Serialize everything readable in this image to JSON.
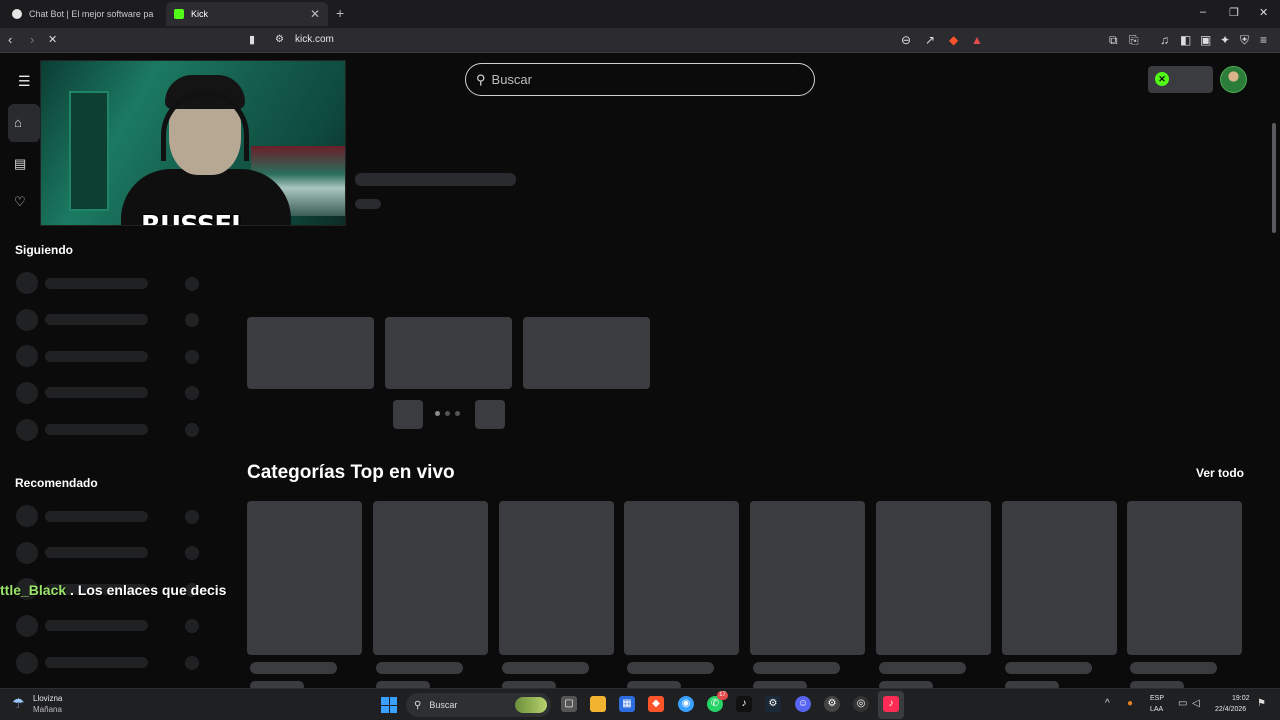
{
  "browser": {
    "tabs": [
      {
        "title": "Chat Bot | El mejor software para pot",
        "active": false,
        "favicon_color": "#e5e5e5"
      },
      {
        "title": "Kick",
        "active": true,
        "favicon_color": "#53fc18"
      }
    ],
    "new_tab_icon": "plus-icon",
    "window_controls": {
      "minimize": "–",
      "restore": "❐",
      "close": "✕"
    },
    "url": "kick.com"
  },
  "header": {
    "menu_icon": "menu-icon",
    "search_placeholder": "Buscar",
    "brand_color": "#53fc18"
  },
  "sidebar": {
    "following_title": "Siguiendo",
    "recommended_title": "Recomendado"
  },
  "main": {
    "categories_title": "Categorías Top en vivo",
    "see_all": "Ver todo"
  },
  "overlay": {
    "streamer_name": "RUSSEL",
    "chat_user": "ttle_Black",
    "chat_message": " . Los enlaces que decis",
    "chat_user_color": "#9be46a"
  },
  "taskbar": {
    "weather_line1": "Llovizna",
    "weather_line2": "Mañana",
    "search_label": "Buscar",
    "notification_count": "17",
    "language": "ESP",
    "layout": "LAA",
    "time": "19:02",
    "date": "22/4/2026"
  }
}
